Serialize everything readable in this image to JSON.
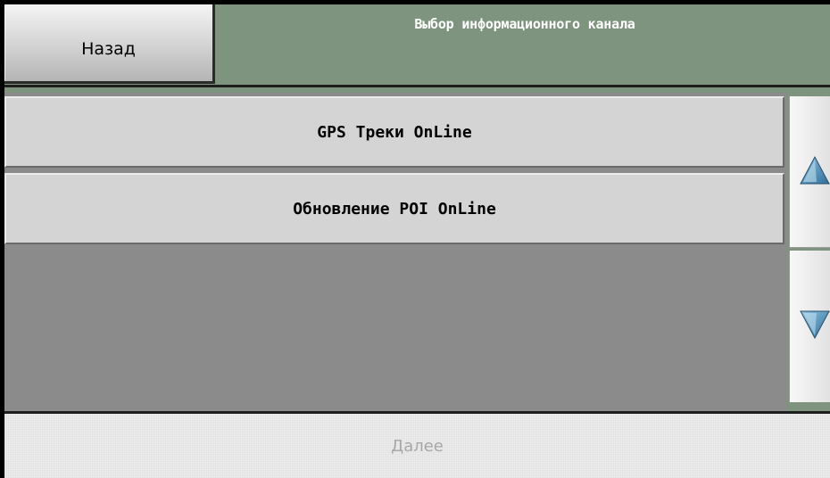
{
  "header": {
    "back_label": "Назад",
    "title": "Выбор информационного канала"
  },
  "channels": [
    {
      "label": "GPS Треки OnLine"
    },
    {
      "label": "Обновление POI OnLine"
    }
  ],
  "scroll": {
    "up_icon": "triangle-up-icon",
    "down_icon": "triangle-down-icon"
  },
  "footer": {
    "next_label": "Далее",
    "next_enabled": false
  },
  "colors": {
    "header_background": "#7e947e",
    "list_background": "#8b8b8b",
    "item_background": "#d4d4d4",
    "title_text": "#ffffff",
    "arrow_fill": "#3f7fa8",
    "disabled_text": "#a8a8a8"
  }
}
